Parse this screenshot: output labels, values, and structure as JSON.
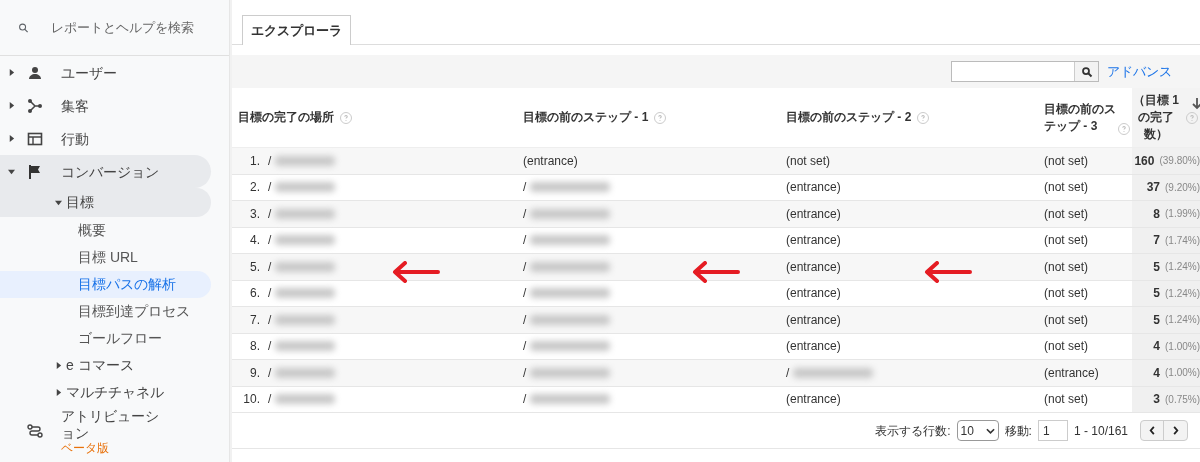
{
  "search": {
    "placeholder": "レポートとヘルプを検索"
  },
  "nav": [
    {
      "label": "ユーザー",
      "expanded": false,
      "selected": false
    },
    {
      "label": "集客",
      "expanded": false,
      "selected": false
    },
    {
      "label": "行動",
      "expanded": false,
      "selected": false
    },
    {
      "label": "コンバージョン",
      "expanded": true,
      "selected": false,
      "children": [
        {
          "label": "目標",
          "expanded": true,
          "selected": false,
          "children": [
            {
              "label": "概要",
              "selected": false
            },
            {
              "label": "目標 URL",
              "selected": false
            },
            {
              "label": "目標パスの解析",
              "selected": true
            },
            {
              "label": "目標到達プロセス",
              "selected": false
            },
            {
              "label": "ゴールフロー",
              "selected": false
            }
          ]
        },
        {
          "label": "e コマース",
          "expanded": false,
          "selected": false
        },
        {
          "label": "マルチチャネル",
          "expanded": false,
          "selected": false
        }
      ]
    },
    {
      "label": "アトリビューション",
      "badge": "ベータ版",
      "selected": false
    }
  ],
  "tabs": [
    {
      "label": "エクスプローラ",
      "selected": true
    }
  ],
  "toolbar": {
    "advanced_link": "アドバンス"
  },
  "table": {
    "columns": [
      "目標の完了の場所",
      "目標の前のステップ - 1",
      "目標の前のステップ - 2",
      "目標の前のステップ - 3",
      "（目標 1 の完了数）"
    ],
    "rows": [
      {
        "index": "1.",
        "cells": [
          {
            "kind": "blurred",
            "text": "/"
          },
          {
            "kind": "plain",
            "text": "(entrance)"
          },
          {
            "kind": "plain",
            "text": "(not set)"
          },
          {
            "kind": "plain",
            "text": "(not set)"
          }
        ],
        "count": "160",
        "share": "(39.80%)"
      },
      {
        "index": "2.",
        "cells": [
          {
            "kind": "blurred",
            "text": "/"
          },
          {
            "kind": "blurred",
            "text": "/"
          },
          {
            "kind": "plain",
            "text": "(entrance)"
          },
          {
            "kind": "plain",
            "text": "(not set)"
          }
        ],
        "count": "37",
        "share": "(9.20%)"
      },
      {
        "index": "3.",
        "cells": [
          {
            "kind": "blurred",
            "text": "/"
          },
          {
            "kind": "blurred",
            "text": "/"
          },
          {
            "kind": "plain",
            "text": "(entrance)"
          },
          {
            "kind": "plain",
            "text": "(not set)"
          }
        ],
        "count": "8",
        "share": "(1.99%)"
      },
      {
        "index": "4.",
        "cells": [
          {
            "kind": "blurred",
            "text": "/"
          },
          {
            "kind": "blurred",
            "text": "/"
          },
          {
            "kind": "plain",
            "text": "(entrance)"
          },
          {
            "kind": "plain",
            "text": "(not set)"
          }
        ],
        "count": "7",
        "share": "(1.74%)"
      },
      {
        "index": "5.",
        "cells": [
          {
            "kind": "blurred",
            "text": "/"
          },
          {
            "kind": "blurred",
            "text": "/"
          },
          {
            "kind": "plain",
            "text": "(entrance)"
          },
          {
            "kind": "plain",
            "text": "(not set)"
          }
        ],
        "count": "5",
        "share": "(1.24%)"
      },
      {
        "index": "6.",
        "cells": [
          {
            "kind": "blurred",
            "text": "/"
          },
          {
            "kind": "blurred",
            "text": "/"
          },
          {
            "kind": "plain",
            "text": "(entrance)"
          },
          {
            "kind": "plain",
            "text": "(not set)"
          }
        ],
        "count": "5",
        "share": "(1.24%)"
      },
      {
        "index": "7.",
        "cells": [
          {
            "kind": "blurred",
            "text": "/"
          },
          {
            "kind": "blurred",
            "text": "/"
          },
          {
            "kind": "plain",
            "text": "(entrance)"
          },
          {
            "kind": "plain",
            "text": "(not set)"
          }
        ],
        "count": "5",
        "share": "(1.24%)"
      },
      {
        "index": "8.",
        "cells": [
          {
            "kind": "blurred",
            "text": "/"
          },
          {
            "kind": "blurred",
            "text": "/"
          },
          {
            "kind": "plain",
            "text": "(entrance)"
          },
          {
            "kind": "plain",
            "text": "(not set)"
          }
        ],
        "count": "4",
        "share": "(1.00%)"
      },
      {
        "index": "9.",
        "cells": [
          {
            "kind": "blurred",
            "text": "/"
          },
          {
            "kind": "blurred",
            "text": "/"
          },
          {
            "kind": "blurred",
            "text": "/"
          },
          {
            "kind": "plain",
            "text": "(entrance)"
          }
        ],
        "count": "4",
        "share": "(1.00%)"
      },
      {
        "index": "10.",
        "cells": [
          {
            "kind": "blurred",
            "text": "/"
          },
          {
            "kind": "blurred",
            "text": "/"
          },
          {
            "kind": "plain",
            "text": "(entrance)"
          },
          {
            "kind": "plain",
            "text": "(not set)"
          }
        ],
        "count": "3",
        "share": "(0.75%)"
      }
    ]
  },
  "pagination": {
    "rows_label": "表示する行数:",
    "rows_value": "10",
    "goto_label": "移動:",
    "goto_value": "1",
    "range": "1 - 10/161"
  }
}
